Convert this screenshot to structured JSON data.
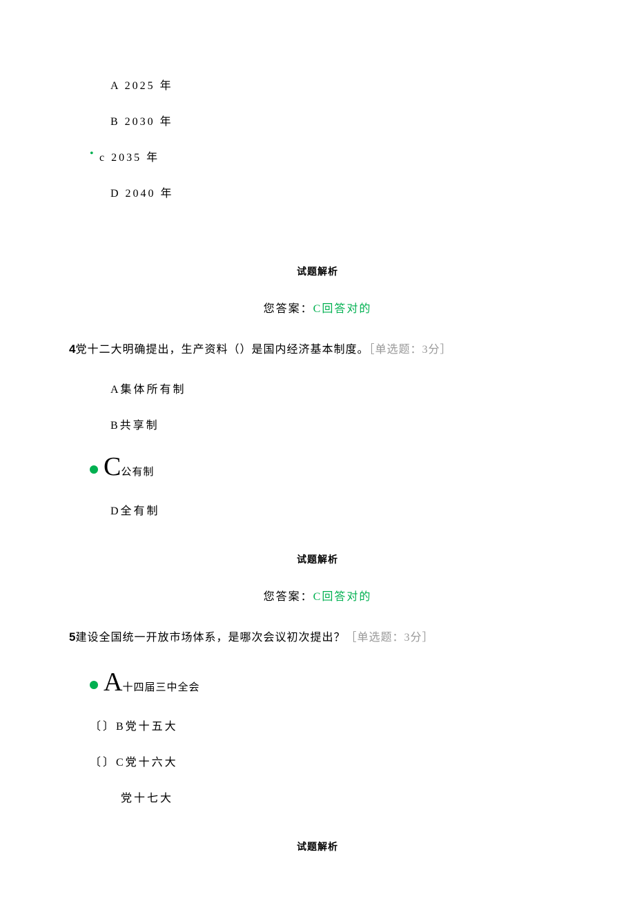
{
  "q3": {
    "options": {
      "a": "A 2025 年",
      "b": "B 2030 年",
      "c_letter": "c",
      "c_text": " 2035 年",
      "d": "D 2040 年"
    },
    "analysis_label": "试题解析",
    "answer_prefix": "您答案：",
    "answer_value": "C回答对的"
  },
  "q4": {
    "num": "4",
    "text": "党十二大明确提出，生产资料（）是国内经济基本制度。",
    "bracket": "［单选题：3分］",
    "options": {
      "a": "A集体所有制",
      "b": "B共享制",
      "c_letter": "C",
      "c_text": "公有制",
      "d": "D全有制"
    },
    "analysis_label": "试题解析",
    "answer_prefix": "您答案：",
    "answer_value": "C回答对的"
  },
  "q5": {
    "num": "5",
    "text": "建设全国统一开放市场体系，是哪次会议初次提出？",
    "bracket": "［单选题：3分］",
    "options": {
      "a_letter": "A",
      "a_text": "十四届三中全会",
      "b": "〔〕B党十五大",
      "c": "〔〕C党十六大",
      "d": "党十七大"
    },
    "analysis_label": "试题解析"
  }
}
